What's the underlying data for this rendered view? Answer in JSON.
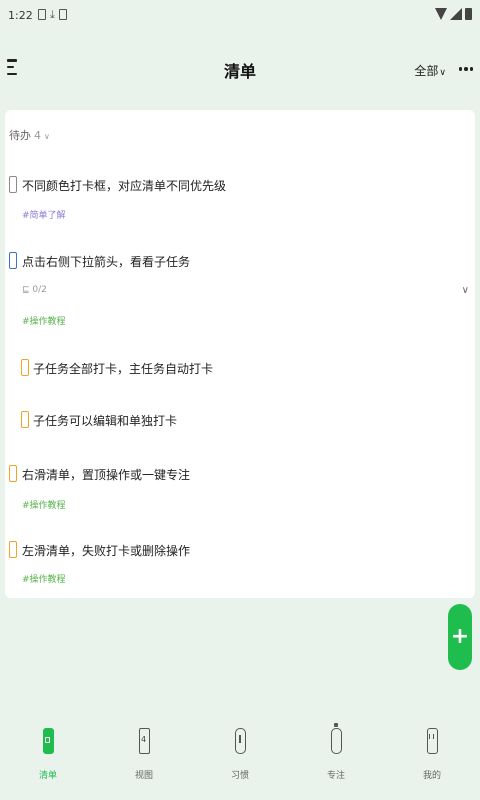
{
  "status_bar": {
    "time": "1:22"
  },
  "header": {
    "title": "清单",
    "filter_label": "全部",
    "filter_chevron": "∨"
  },
  "section": {
    "title": "待办",
    "count": "4",
    "chevron": "∨"
  },
  "tasks": [
    {
      "title": "不同颜色打卡框，对应清单不同优先级",
      "tag": "#简单了解",
      "checkbox_color": "#8a8a8a",
      "tag_color": "#8a7ad6"
    },
    {
      "title": "点击右侧下拉箭头，看看子任务",
      "subtask_count": "0/2",
      "subtask_icon": "⊑",
      "expand": "∨",
      "tag": "#操作教程",
      "checkbox_color": "#3d6fd6",
      "tag_color": "#57b34a"
    },
    {
      "title": "子任务全部打卡，主任务自动打卡",
      "checkbox_color": "#f0a32a"
    },
    {
      "title": "子任务可以编辑和单独打卡",
      "checkbox_color": "#f0a32a"
    },
    {
      "title": "右滑清单，置顶操作或一键专注",
      "tag": "#操作教程",
      "checkbox_color": "#f0a32a",
      "tag_color": "#57b34a"
    },
    {
      "title": "左滑清单，失败打卡或删除操作",
      "tag": "#操作教程",
      "checkbox_color": "#f0a32a",
      "tag_color": "#57b34a"
    }
  ],
  "fab": {
    "label": "+"
  },
  "calendar_day": "4",
  "bottom_nav": [
    {
      "label": "清单",
      "icon": "checklist-icon",
      "active": true
    },
    {
      "label": "视图",
      "icon": "calendar-icon",
      "active": false
    },
    {
      "label": "习惯",
      "icon": "clock-icon",
      "active": false
    },
    {
      "label": "专注",
      "icon": "timer-icon",
      "active": false
    },
    {
      "label": "我的",
      "icon": "profile-icon",
      "active": false
    }
  ],
  "colors": {
    "accent": "#1ebd4e",
    "background": "#e9f3ec",
    "card": "#ffffff"
  }
}
